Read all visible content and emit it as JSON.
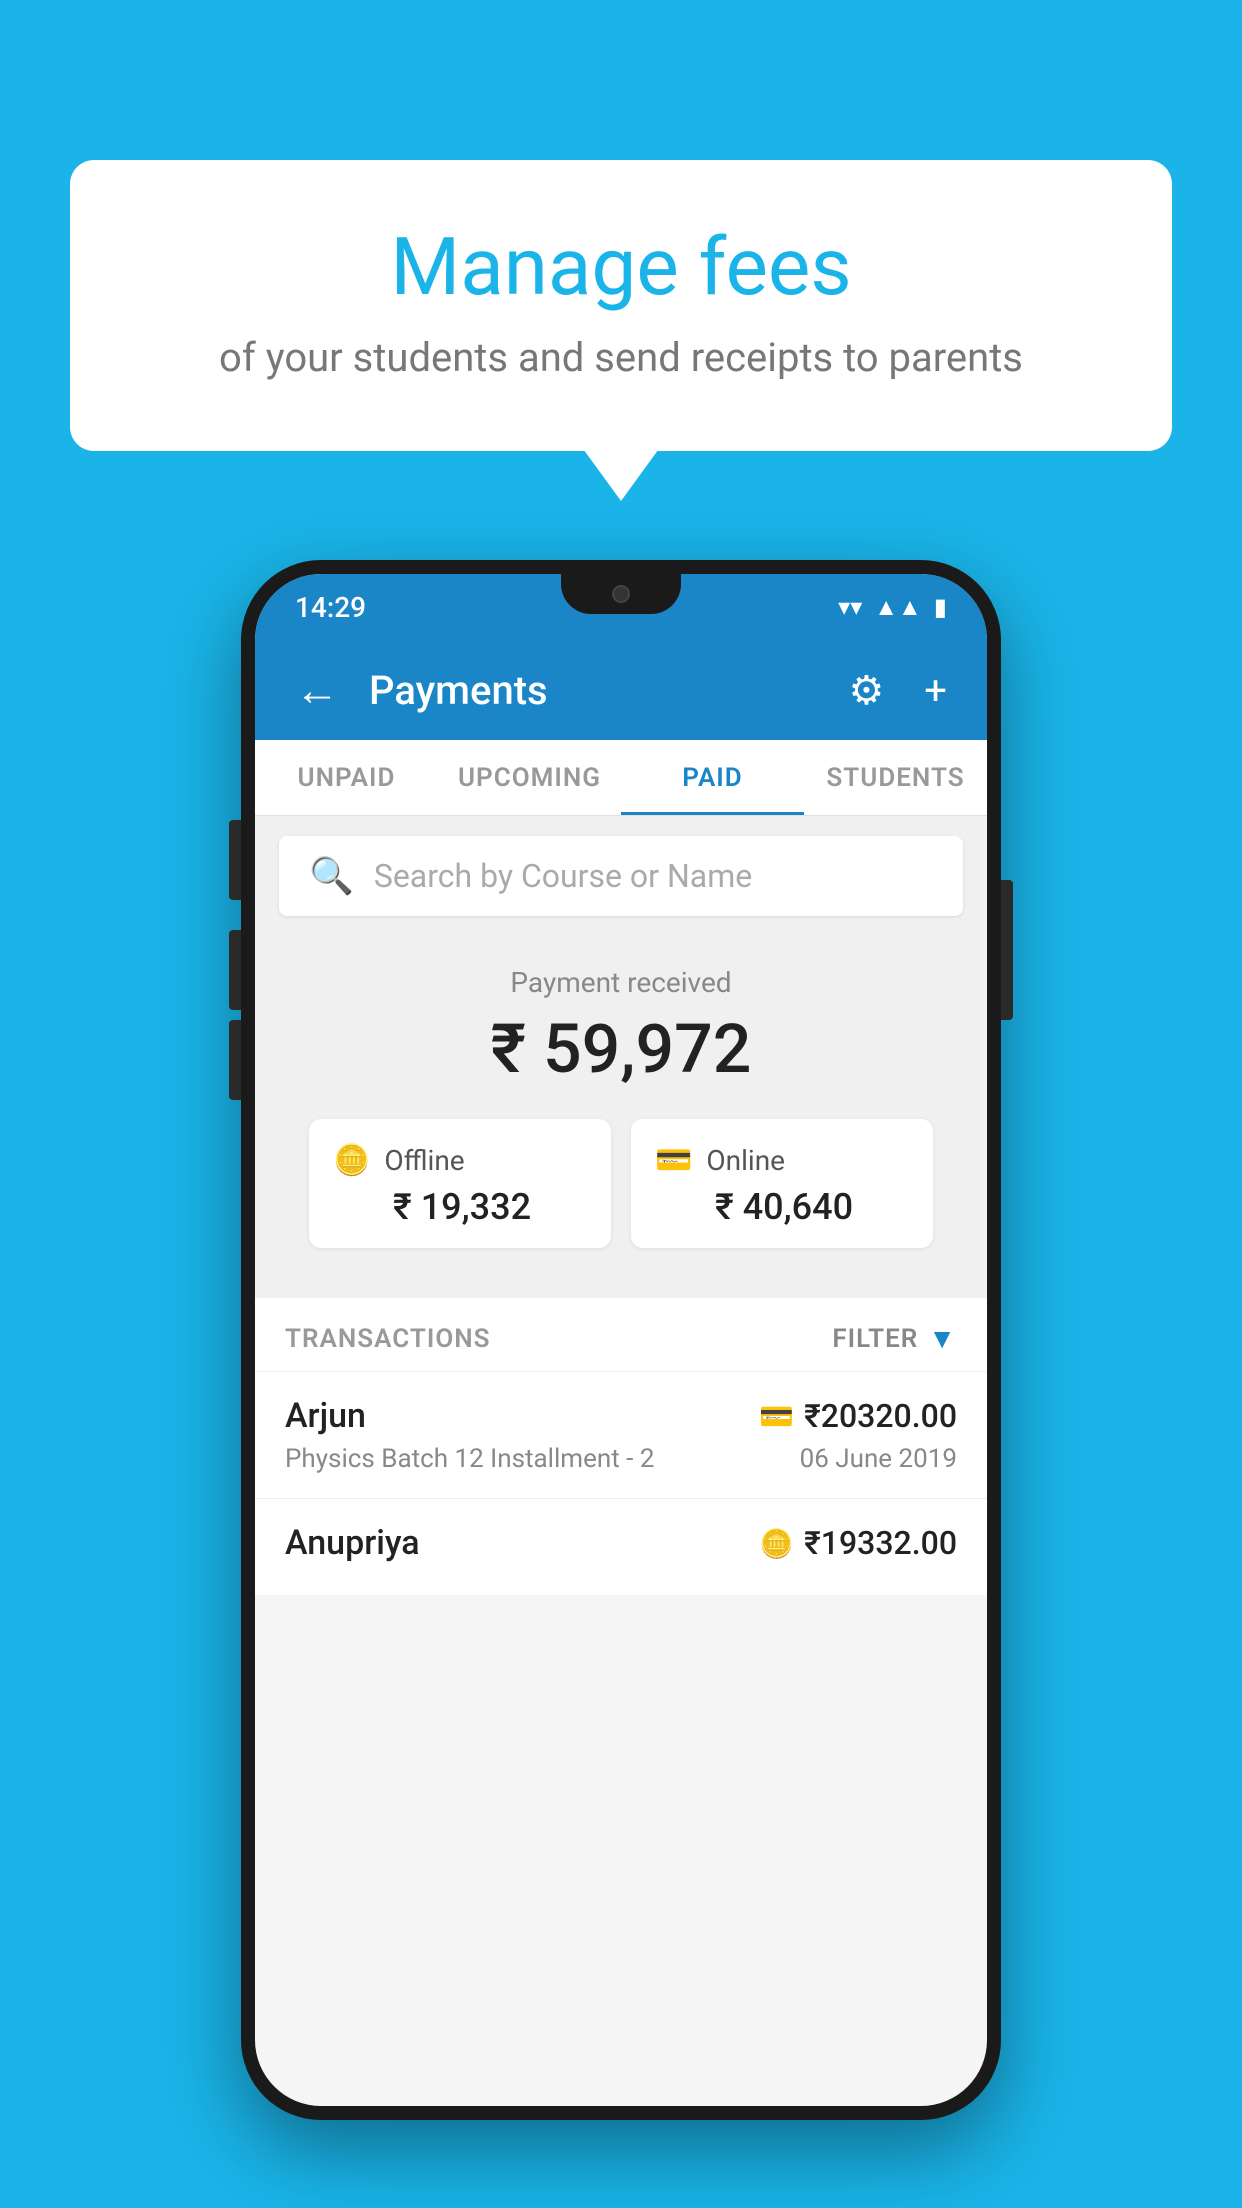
{
  "page": {
    "background_color": "#1ab4e8"
  },
  "speech_bubble": {
    "title": "Manage fees",
    "subtitle": "of your students and send receipts to parents"
  },
  "phone": {
    "status_bar": {
      "time": "14:29"
    },
    "app_bar": {
      "title": "Payments",
      "back_label": "←",
      "gear_label": "⚙",
      "plus_label": "+"
    },
    "tabs": [
      {
        "label": "UNPAID",
        "active": false
      },
      {
        "label": "UPCOMING",
        "active": false
      },
      {
        "label": "PAID",
        "active": true
      },
      {
        "label": "STUDENTS",
        "active": false
      }
    ],
    "search": {
      "placeholder": "Search by Course or Name"
    },
    "payment_summary": {
      "label": "Payment received",
      "amount": "₹ 59,972"
    },
    "payment_cards": [
      {
        "type": "Offline",
        "amount": "₹ 19,332",
        "icon": "💳"
      },
      {
        "type": "Online",
        "amount": "₹ 40,640",
        "icon": "💳"
      }
    ],
    "transactions": {
      "label": "TRANSACTIONS",
      "filter_label": "FILTER",
      "items": [
        {
          "name": "Arjun",
          "course": "Physics Batch 12 Installment - 2",
          "amount": "₹20320.00",
          "date": "06 June 2019",
          "payment_type": "online"
        },
        {
          "name": "Anupriya",
          "course": "",
          "amount": "₹19332.00",
          "date": "",
          "payment_type": "offline"
        }
      ]
    }
  }
}
